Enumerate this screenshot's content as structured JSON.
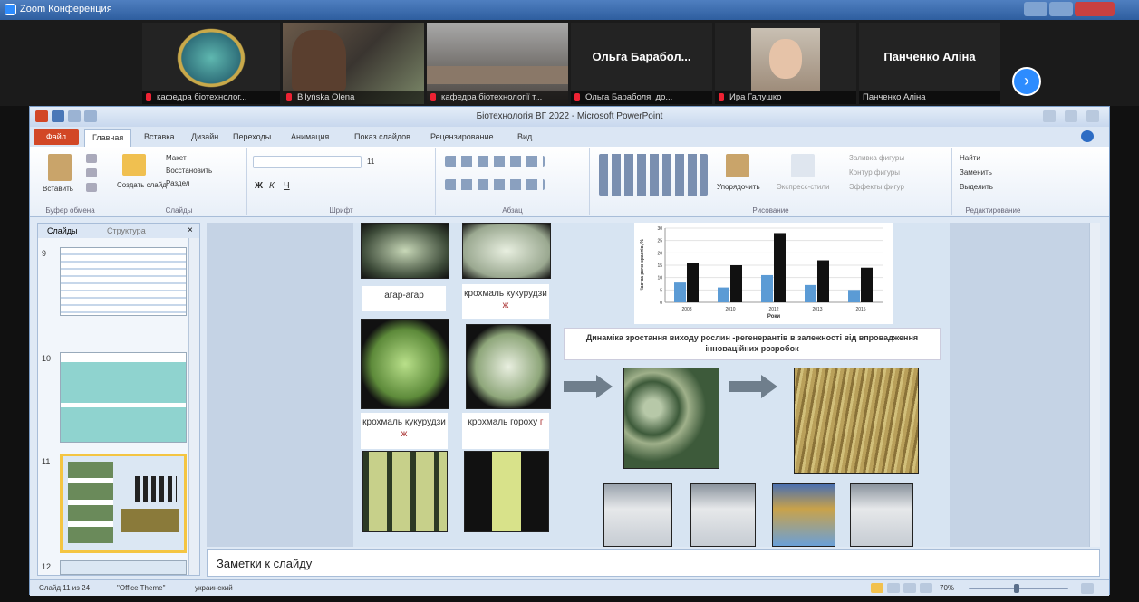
{
  "zoom": {
    "title": "Zoom Конференция"
  },
  "participants": [
    {
      "label": "кафедра біотехнолог..."
    },
    {
      "label": "Bilyńska Olena"
    },
    {
      "label": "кафедра біотехнології т..."
    },
    {
      "name": "Ольга Барабол...",
      "label": "Ольга Бараболя, до..."
    },
    {
      "label": "Ира Галушко"
    },
    {
      "name": "Панченко Аліна",
      "label": "Панченко Аліна"
    }
  ],
  "ppt": {
    "window_title": "Біотехнологія ВГ 2022 - Microsoft PowerPoint",
    "tabs": [
      "Файл",
      "Главная",
      "Вставка",
      "Дизайн",
      "Переходы",
      "Анимация",
      "Показ слайдов",
      "Рецензирование",
      "Вид"
    ],
    "ribbon": {
      "clipboard": {
        "paste": "Вставить",
        "label": "Буфер обмена"
      },
      "slides": {
        "layout": "Макет",
        "reset": "Восстановить",
        "new_slide": "Создать слайд",
        "section": "Раздел",
        "label": "Слайды"
      },
      "font": {
        "size": "11",
        "label": "Шрифт"
      },
      "paragraph": {
        "label": "Абзац"
      },
      "drawing": {
        "arrange": "Упорядочить",
        "quick_styles": "Экспресс-стили",
        "fill": "Заливка фигуры",
        "outline": "Контур фигуры",
        "effects": "Эффекты фигур",
        "label": "Рисование"
      },
      "editing": {
        "find": "Найти",
        "replace": "Заменить",
        "select": "Выделить",
        "label": "Редактирование"
      }
    },
    "pane_tabs": [
      "Слайды",
      "Структура"
    ],
    "thumbs": [
      {
        "num": "9"
      },
      {
        "num": "10"
      },
      {
        "num": "11"
      },
      {
        "num": "12"
      }
    ],
    "slide": {
      "labels": [
        "агар-агар",
        "крохмаль кукурудзи ",
        "крохмаль кукурудзи ",
        "крохмаль гороху"
      ],
      "label_suffix": [
        "ж",
        "ж",
        "г"
      ],
      "caption": "Динаміка зростання виходу рослин -регенерантів в залежності від впровадження інноваційних розробок",
      "chart_ylabel": "Частка регенерантів, %",
      "chart_xlabel": "Роки"
    },
    "notes_placeholder": "Заметки к слайду",
    "status": {
      "slide_of": "Слайд 11 из 24",
      "theme": "\"Office Theme\"",
      "lang": "украинский",
      "zoom": "70%"
    }
  },
  "chart_data": {
    "type": "bar",
    "categories": [
      "2008",
      "2010",
      "2012",
      "2013",
      "2015"
    ],
    "series": [
      {
        "values": [
          8,
          6,
          11,
          7,
          5
        ]
      },
      {
        "values": [
          16,
          15,
          28,
          17,
          14
        ]
      }
    ],
    "ylim": [
      0,
      30
    ],
    "xlabel": "Роки",
    "ylabel": "Частка регенерантів, %"
  }
}
